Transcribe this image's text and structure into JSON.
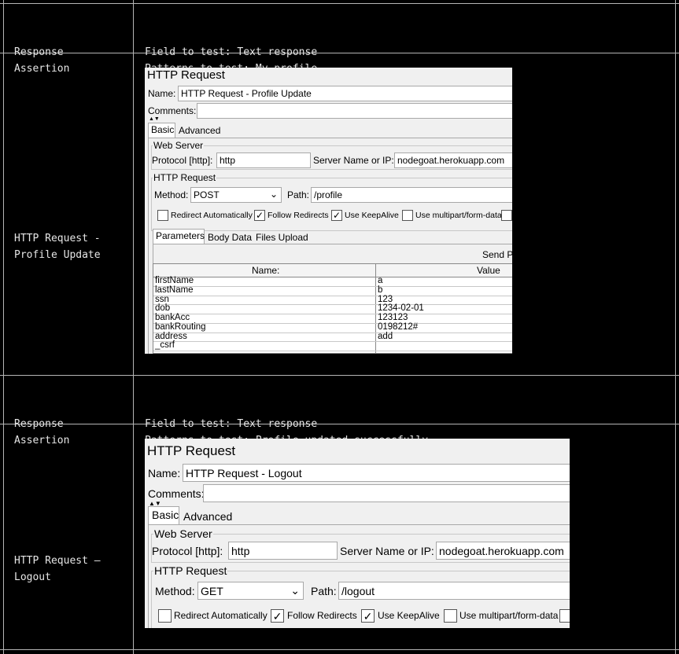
{
  "rows": [
    {
      "label_lines": [
        "Response",
        "Assertion"
      ],
      "content_lines": [
        "Field to test: Text response",
        "Patterns to test: My profile"
      ]
    },
    {
      "label_lines": [
        "HTTP Request -",
        "Profile Update"
      ],
      "screenshot": {
        "title": "HTTP Request",
        "name_label": "Name:",
        "name_value": "HTTP Request - Profile Update",
        "comments_label": "Comments:",
        "tabs": [
          "Basic",
          "Advanced"
        ],
        "web_server_label": "Web Server",
        "protocol_label": "Protocol [http]:",
        "protocol_value": "http",
        "server_label": "Server Name or IP:",
        "server_value": "nodegoat.herokuapp.com",
        "http_request_label": "HTTP Request",
        "method_label": "Method:",
        "method_value": "POST",
        "path_label": "Path:",
        "path_value": "/profile",
        "checkboxes": [
          {
            "label": "Redirect Automatically",
            "checked": false
          },
          {
            "label": "Follow Redirects",
            "checked": true
          },
          {
            "label": "Use KeepAlive",
            "checked": true
          },
          {
            "label": "Use multipart/form-data",
            "checked": false
          }
        ],
        "sub_tabs": [
          "Parameters",
          "Body Data",
          "Files Upload"
        ],
        "send_label": "Send P",
        "columns": [
          "Name:",
          "Value"
        ],
        "params": [
          {
            "name": "firstName",
            "value": "a"
          },
          {
            "name": "lastName",
            "value": "b"
          },
          {
            "name": "ssn",
            "value": "123"
          },
          {
            "name": "dob",
            "value": "1234-02-01"
          },
          {
            "name": "bankAcc",
            "value": "123123"
          },
          {
            "name": "bankRouting",
            "value": "0198212#"
          },
          {
            "name": "address",
            "value": "add"
          },
          {
            "name": "_csrf",
            "value": ""
          }
        ]
      }
    },
    {
      "label_lines": [
        "Response",
        "Assertion"
      ],
      "content_lines": [
        "Field to test: Text response",
        "Patterns to test: Profile updated successfully"
      ]
    },
    {
      "label_lines": [
        "HTTP Request –",
        "Logout"
      ],
      "screenshot": {
        "title": "HTTP Request",
        "name_label": "Name:",
        "name_value": "HTTP Request - Logout",
        "comments_label": "Comments:",
        "tabs": [
          "Basic",
          "Advanced"
        ],
        "web_server_label": "Web Server",
        "protocol_label": "Protocol [http]:",
        "protocol_value": "http",
        "server_label": "Server Name or IP:",
        "server_value": "nodegoat.herokuapp.com",
        "http_request_label": "HTTP Request",
        "method_label": "Method:",
        "method_value": "GET",
        "path_label": "Path:",
        "path_value": "/logout",
        "checkboxes": [
          {
            "label": "Redirect Automatically",
            "checked": false
          },
          {
            "label": "Follow Redirects",
            "checked": true
          },
          {
            "label": "Use KeepAlive",
            "checked": true
          },
          {
            "label": "Use multipart/form-data",
            "checked": false
          }
        ]
      }
    }
  ]
}
